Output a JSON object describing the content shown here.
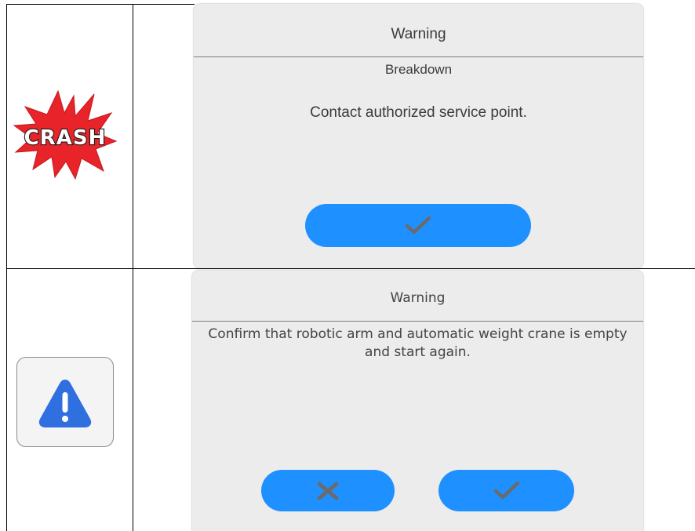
{
  "rows": [
    {
      "icon": {
        "name": "crash-icon",
        "text": "CRASH",
        "colors": {
          "burst": "#e8232a",
          "text_fill": "#ffffff",
          "text_stroke": "#1a1a1a"
        }
      },
      "dialog": {
        "title": "Warning",
        "subtitle": "Breakdown",
        "message": "Contact authorized service point.",
        "buttons": [
          {
            "type": "confirm",
            "icon": "checkmark-icon"
          }
        ]
      }
    },
    {
      "icon": {
        "name": "warning-icon",
        "colors": {
          "triangle": "#2f6fe0",
          "mark": "#ffffff"
        }
      },
      "dialog": {
        "title": "Warning",
        "message": "Confirm that robotic arm and automatic weight crane is empty and start again.",
        "buttons": [
          {
            "type": "cancel",
            "icon": "close-icon"
          },
          {
            "type": "confirm",
            "icon": "checkmark-icon"
          }
        ]
      }
    }
  ],
  "colors": {
    "dialog_bg": "#ececec",
    "button_bg": "#1e90ff",
    "button_icon": "#6b6b6b",
    "text": "#3b3b3b"
  }
}
